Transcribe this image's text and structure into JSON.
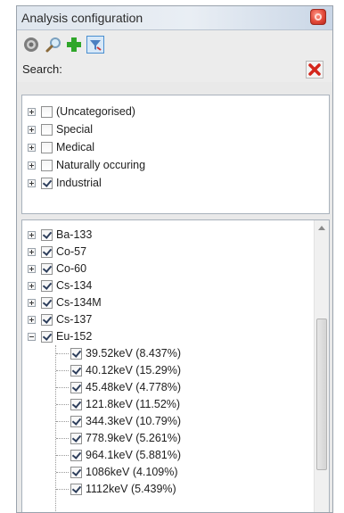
{
  "window": {
    "title": "Analysis configuration"
  },
  "icons": {
    "toolbar": [
      "settings-icon",
      "search-icon",
      "add-icon",
      "filter-icon"
    ],
    "close": "close-icon",
    "clear": "clear-icon"
  },
  "colors": {
    "add_green": "#2fa62a",
    "clear_red": "#d4261c",
    "close_red": "#e34a3a"
  },
  "search": {
    "label": "Search:",
    "value": ""
  },
  "categories": [
    {
      "label": "(Uncategorised)",
      "checked": false
    },
    {
      "label": "Special",
      "checked": false
    },
    {
      "label": "Medical",
      "checked": false
    },
    {
      "label": "Naturally occuring",
      "checked": false
    },
    {
      "label": "Industrial",
      "checked": true
    }
  ],
  "isotopes": [
    {
      "label": "Ba-133",
      "checked": true
    },
    {
      "label": "Co-57",
      "checked": true
    },
    {
      "label": "Co-60",
      "checked": true
    },
    {
      "label": "Cs-134",
      "checked": true
    },
    {
      "label": "Cs-134M",
      "checked": true
    },
    {
      "label": "Cs-137",
      "checked": true
    },
    {
      "label": "Eu-152",
      "checked": true,
      "expanded": true
    }
  ],
  "eu152_lines": [
    {
      "label": "39.52keV (8.437%)",
      "checked": true
    },
    {
      "label": "40.12keV (15.29%)",
      "checked": true
    },
    {
      "label": "45.48keV (4.778%)",
      "checked": true
    },
    {
      "label": "121.8keV (11.52%)",
      "checked": true
    },
    {
      "label": "344.3keV (10.79%)",
      "checked": true
    },
    {
      "label": "778.9keV (5.261%)",
      "checked": true
    },
    {
      "label": "964.1keV (5.881%)",
      "checked": true
    },
    {
      "label": "1086keV (4.109%)",
      "checked": true
    },
    {
      "label": "1112keV (5.439%)",
      "checked": true
    }
  ]
}
